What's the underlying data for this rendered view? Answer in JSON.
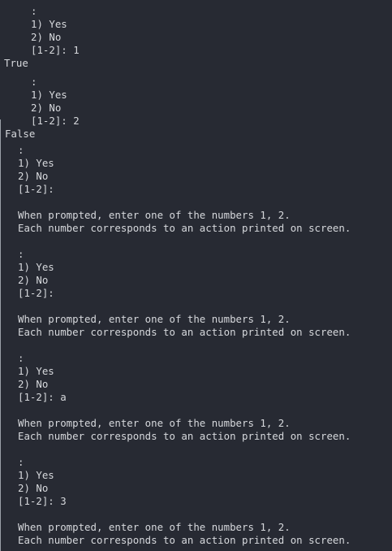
{
  "terminal": {
    "block1": {
      "colon": ":",
      "opt1": "1) Yes",
      "opt2": "2) No",
      "prompt": "[1-2]: 1",
      "result": "True"
    },
    "block2": {
      "colon": ":",
      "opt1": "1) Yes",
      "opt2": "2) No",
      "prompt": "[1-2]: 2",
      "result": "False"
    },
    "block3": {
      "colon": ":",
      "opt1": "1) Yes",
      "opt2": "2) No",
      "prompt": "[1-2]:",
      "help1": "When prompted, enter one of the numbers 1, 2.",
      "help2": "Each number corresponds to an action printed on screen."
    },
    "block4": {
      "colon": ":",
      "opt1": "1) Yes",
      "opt2": "2) No",
      "prompt": "[1-2]:",
      "help1": "When prompted, enter one of the numbers 1, 2.",
      "help2": "Each number corresponds to an action printed on screen."
    },
    "block5": {
      "colon": ":",
      "opt1": "1) Yes",
      "opt2": "2) No",
      "prompt": "[1-2]: a",
      "help1": "When prompted, enter one of the numbers 1, 2.",
      "help2": "Each number corresponds to an action printed on screen."
    },
    "block6": {
      "colon": ":",
      "opt1": "1) Yes",
      "opt2": "2) No",
      "prompt": "[1-2]: 3",
      "help1": "When prompted, enter one of the numbers 1, 2.",
      "help2": "Each number corresponds to an action printed on screen."
    }
  }
}
